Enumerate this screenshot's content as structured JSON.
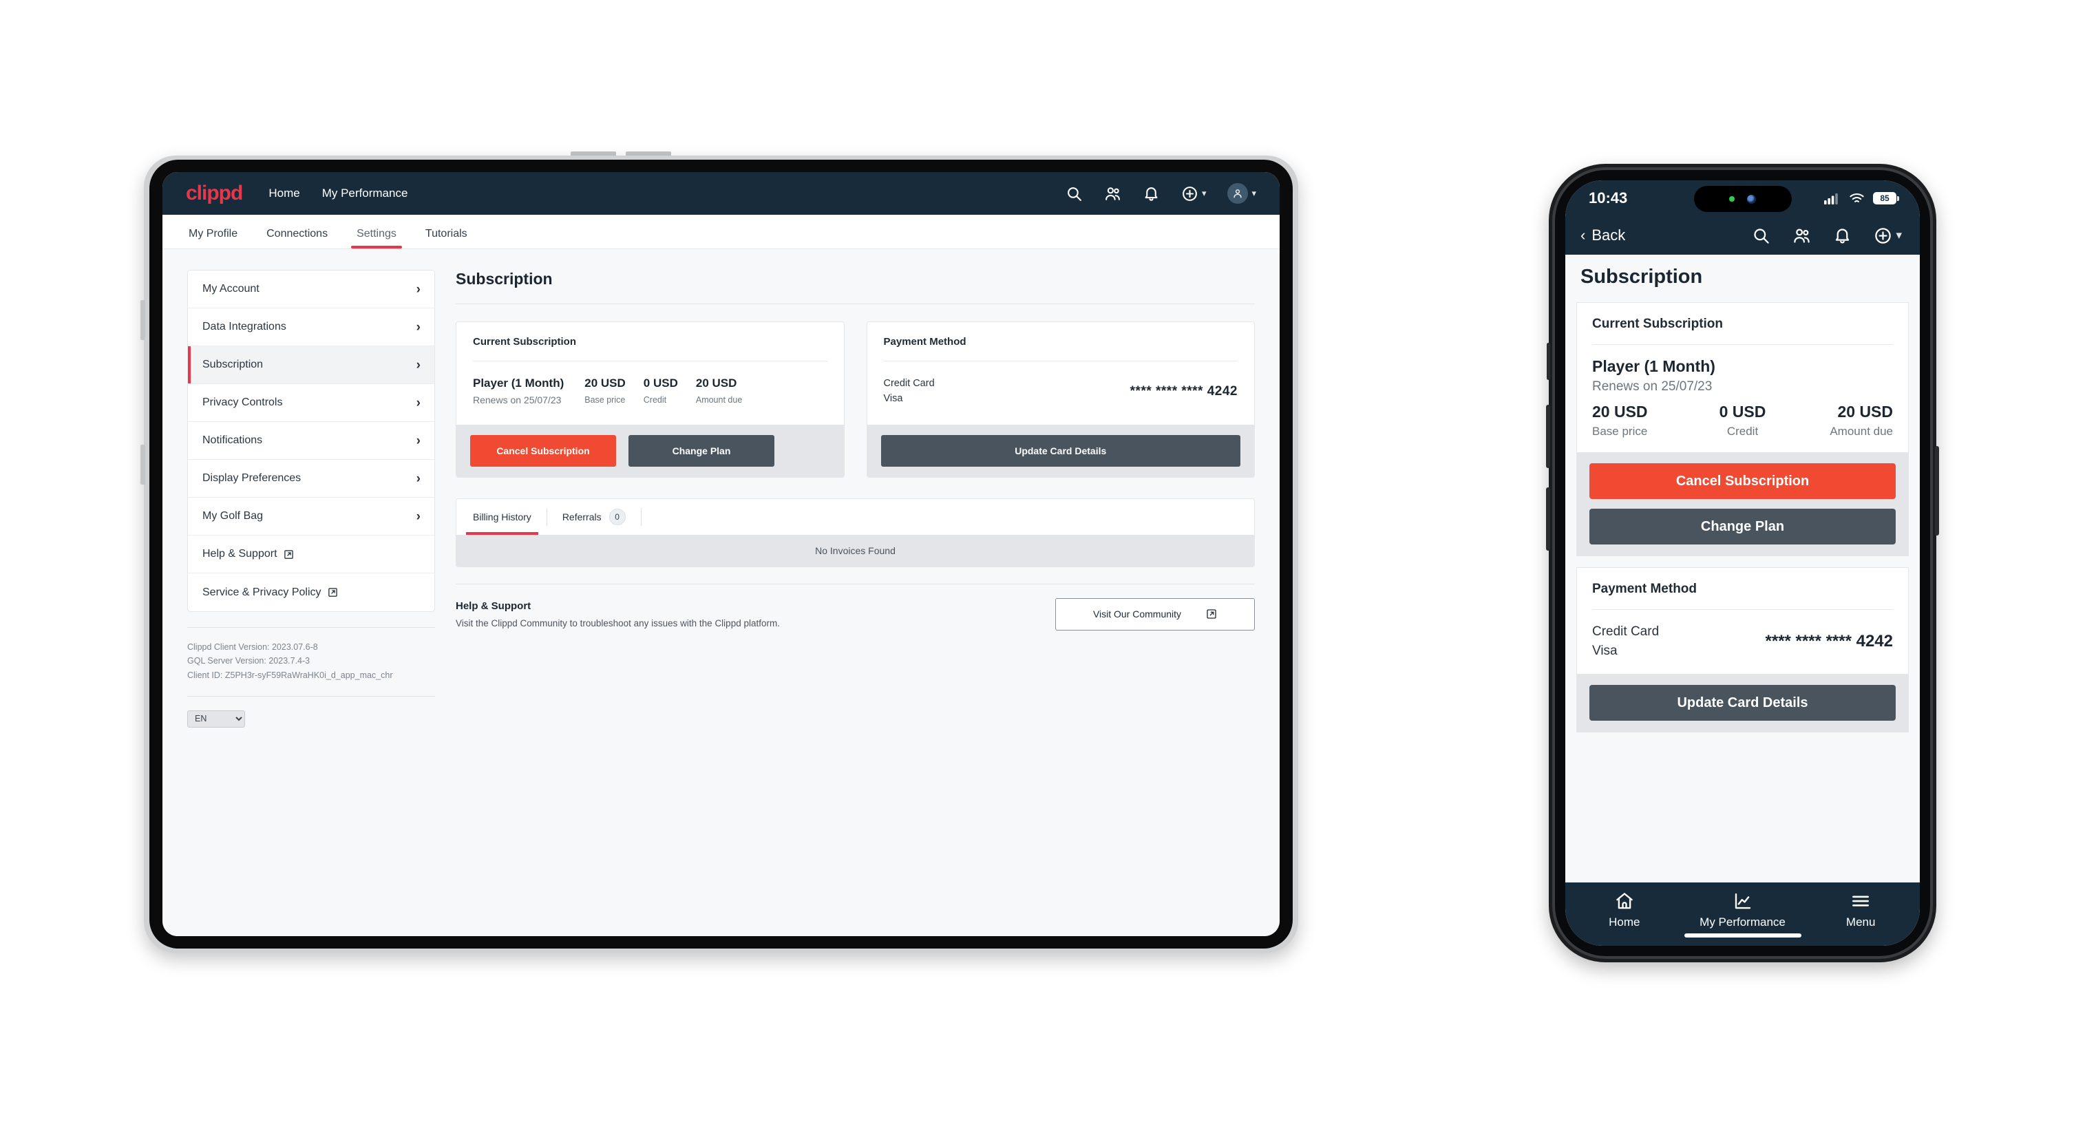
{
  "brand": {
    "name": "clippd",
    "accent": "#e8374b",
    "dark": "#182b3a",
    "danger": "#f04a33",
    "slate": "#49545e"
  },
  "tablet": {
    "topnav": {
      "logo": "clippd",
      "links": [
        "Home",
        "My Performance"
      ],
      "icons": [
        "search-icon",
        "people-icon",
        "bell-icon",
        "plus-circle-icon",
        "avatar-icon"
      ]
    },
    "tabs": [
      {
        "label": "My Profile",
        "active": false
      },
      {
        "label": "Connections",
        "active": false
      },
      {
        "label": "Settings",
        "active": true
      },
      {
        "label": "Tutorials",
        "active": false
      }
    ],
    "sidebar": {
      "items": [
        {
          "label": "My Account",
          "active": false,
          "external": false
        },
        {
          "label": "Data Integrations",
          "active": false,
          "external": false
        },
        {
          "label": "Subscription",
          "active": true,
          "external": false
        },
        {
          "label": "Privacy Controls",
          "active": false,
          "external": false
        },
        {
          "label": "Notifications",
          "active": false,
          "external": false
        },
        {
          "label": "Display Preferences",
          "active": false,
          "external": false
        },
        {
          "label": "My Golf Bag",
          "active": false,
          "external": false
        },
        {
          "label": "Help & Support",
          "active": false,
          "external": true
        },
        {
          "label": "Service & Privacy Policy",
          "active": false,
          "external": true
        }
      ],
      "meta": {
        "client_version": "Clippd Client Version: 2023.07.6-8",
        "server_version": "GQL Server Version: 2023.7.4-3",
        "client_id": "Client ID: Z5PH3r-syF59RaWraHK0i_d_app_mac_chr"
      },
      "language": {
        "selected": "EN",
        "options": [
          "EN"
        ]
      }
    },
    "main": {
      "page_title": "Subscription",
      "subscription_card": {
        "title": "Current Subscription",
        "plan_name": "Player (1 Month)",
        "renews": "Renews on 25/07/23",
        "figures": [
          {
            "value": "20 USD",
            "label": "Base price"
          },
          {
            "value": "0 USD",
            "label": "Credit"
          },
          {
            "value": "20 USD",
            "label": "Amount due"
          }
        ],
        "cancel_label": "Cancel Subscription",
        "change_label": "Change Plan"
      },
      "payment_card": {
        "title": "Payment Method",
        "type": "Credit Card",
        "brand": "Visa",
        "masked_number": "**** **** **** 4242",
        "update_label": "Update Card Details"
      },
      "history": {
        "tabs": [
          {
            "label": "Billing History",
            "active": true,
            "badge": null
          },
          {
            "label": "Referrals",
            "active": false,
            "badge": "0"
          }
        ],
        "empty_text": "No Invoices Found"
      },
      "help": {
        "title": "Help & Support",
        "subtitle": "Visit the Clippd Community to troubleshoot any issues with the Clippd platform.",
        "button_label": "Visit Our Community"
      }
    }
  },
  "phone": {
    "status": {
      "time": "10:43",
      "battery": "85",
      "signal_icon": "cellular-icon",
      "wifi_icon": "wifi-icon"
    },
    "nav": {
      "back_label": "Back",
      "icons": [
        "search-icon",
        "people-icon",
        "bell-icon",
        "plus-circle-icon"
      ]
    },
    "page_title": "Subscription",
    "subscription_card": {
      "title": "Current Subscription",
      "plan_name": "Player (1 Month)",
      "renews": "Renews on 25/07/23",
      "figures": [
        {
          "value": "20 USD",
          "label": "Base price"
        },
        {
          "value": "0 USD",
          "label": "Credit"
        },
        {
          "value": "20 USD",
          "label": "Amount due"
        }
      ],
      "cancel_label": "Cancel Subscription",
      "change_label": "Change Plan"
    },
    "payment_card": {
      "title": "Payment Method",
      "type": "Credit Card",
      "brand": "Visa",
      "masked_number": "**** **** **** 4242",
      "update_label": "Update Card Details"
    },
    "tabbar": [
      {
        "label": "Home",
        "icon": "home-icon"
      },
      {
        "label": "My Performance",
        "icon": "chart-icon"
      },
      {
        "label": "Menu",
        "icon": "hamburger-icon"
      }
    ]
  }
}
